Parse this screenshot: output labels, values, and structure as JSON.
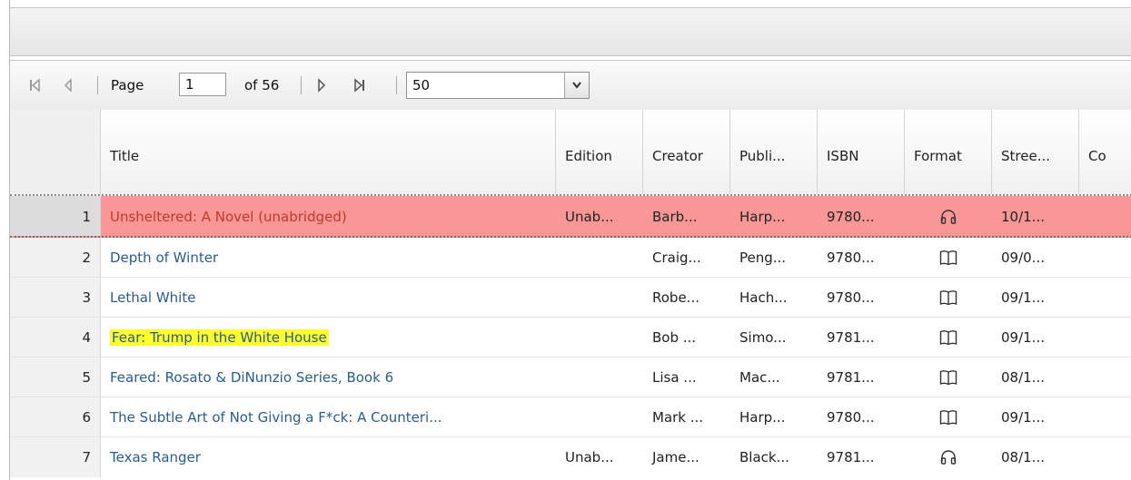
{
  "pager": {
    "page_label": "Page",
    "page_value": "1",
    "of_label": "of 56",
    "page_size": "50"
  },
  "columns": [
    "Title",
    "Edition",
    "Creator",
    "Publi...",
    "ISBN",
    "Format",
    "Stree...",
    "Co"
  ],
  "rows": [
    {
      "num": "1",
      "title": "Unsheltered: A Novel (unabridged)",
      "edition": "Unab...",
      "creator": "Barb...",
      "publisher": "Harp...",
      "isbn": "9780...",
      "format": "audiobook-icon",
      "street": "10/1..."
    },
    {
      "num": "2",
      "title": "Depth of Winter",
      "edition": "",
      "creator": "Craig...",
      "publisher": "Peng...",
      "isbn": "9780...",
      "format": "ebook-icon",
      "street": "09/0..."
    },
    {
      "num": "3",
      "title": "Lethal White",
      "edition": "",
      "creator": "Robe...",
      "publisher": "Hach...",
      "isbn": "9780...",
      "format": "ebook-icon",
      "street": "09/1..."
    },
    {
      "num": "4",
      "title": "Fear: Trump in the White House",
      "edition": "",
      "creator": "Bob ...",
      "publisher": "Simo...",
      "isbn": "9781...",
      "format": "ebook-icon",
      "street": "09/1..."
    },
    {
      "num": "5",
      "title": "Feared: Rosato & DiNunzio Series, Book 6",
      "edition": "",
      "creator": "Lisa ...",
      "publisher": "Mac...",
      "isbn": "9781...",
      "format": "ebook-icon",
      "street": "08/1..."
    },
    {
      "num": "6",
      "title": "The Subtle Art of Not Giving a F*ck: A Counteri...",
      "edition": "",
      "creator": "Mark ...",
      "publisher": "Harp...",
      "isbn": "9780...",
      "format": "ebook-icon",
      "street": "09/1..."
    },
    {
      "num": "7",
      "title": "Texas Ranger",
      "edition": "Unab...",
      "creator": "Jame...",
      "publisher": "Black...",
      "isbn": "9781...",
      "format": "audiobook-icon",
      "street": "08/1..."
    }
  ],
  "colors": {
    "selected_row": "#f99797",
    "title_link": "#2a5d8c",
    "selected_title": "#c0392b",
    "highlight": "#ffff2e"
  }
}
